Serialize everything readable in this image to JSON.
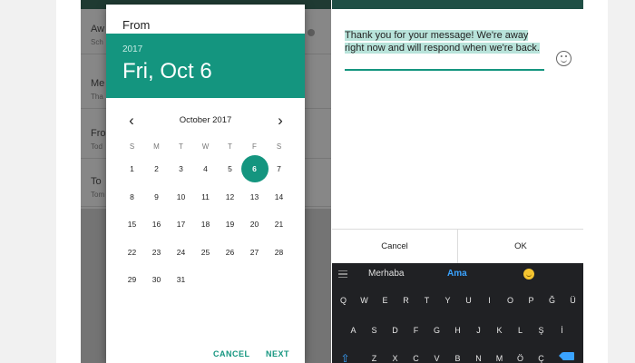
{
  "background_list": {
    "rows": [
      {
        "title": "Aw",
        "subtitle": "Sch"
      },
      {
        "title": "Me",
        "subtitle": "Tha"
      },
      {
        "title": "Fro",
        "subtitle": "Tod"
      },
      {
        "title": "To",
        "subtitle": "Tom"
      }
    ]
  },
  "date_picker": {
    "title": "From",
    "year": "2017",
    "selected_date": "Fri, Oct 6",
    "month_label": "October 2017",
    "prev_icon": "‹",
    "next_icon": "›",
    "weekdays": [
      "S",
      "M",
      "T",
      "W",
      "T",
      "F",
      "S"
    ],
    "first_weekday_offset": 0,
    "days": [
      "1",
      "2",
      "3",
      "4",
      "5",
      "6",
      "7",
      "8",
      "9",
      "10",
      "11",
      "12",
      "13",
      "14",
      "15",
      "16",
      "17",
      "18",
      "19",
      "20",
      "21",
      "22",
      "23",
      "24",
      "25",
      "26",
      "27",
      "28",
      "29",
      "30",
      "31"
    ],
    "selected_day": "6",
    "cancel_label": "CANCEL",
    "next_label": "NEXT",
    "accent_color": "#14957f"
  },
  "away_message": {
    "text": "Thank you for your message! We're away right now and will respond when we're back.",
    "cancel_label": "Cancel",
    "ok_label": "OK",
    "emoji_icon": "smiley-icon"
  },
  "keyboard": {
    "suggestions": [
      "Merhaba",
      "Ama"
    ],
    "suggestion_emoji": "grinning-emoji",
    "rows": [
      [
        "Q",
        "W",
        "E",
        "R",
        "T",
        "Y",
        "U",
        "I",
        "O",
        "P",
        "Ğ",
        "Ü"
      ],
      [
        "A",
        "S",
        "D",
        "F",
        "G",
        "H",
        "J",
        "K",
        "L",
        "Ş",
        "İ"
      ],
      [
        "Z",
        "X",
        "C",
        "V",
        "B",
        "N",
        "M",
        "Ö",
        "Ç"
      ]
    ],
    "shift_icon": "⇧",
    "delete_icon": "backspace-icon",
    "highlight_color": "#3aa3ff"
  }
}
